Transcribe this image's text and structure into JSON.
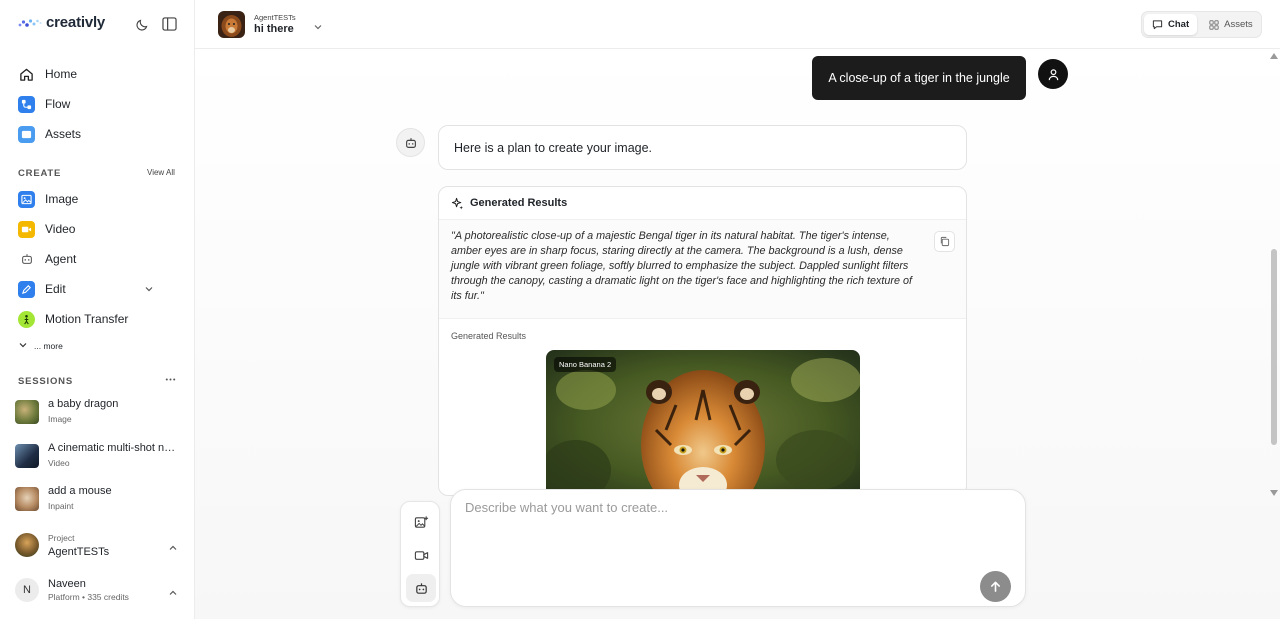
{
  "app": {
    "logo_text": "creativly"
  },
  "sidebar": {
    "nav": [
      {
        "label": "Home",
        "icon": "home-icon"
      },
      {
        "label": "Flow",
        "icon": "flow-icon"
      },
      {
        "label": "Assets",
        "icon": "folder-icon"
      }
    ],
    "create_label": "CREATE",
    "view_all": "View All",
    "create_items": [
      {
        "label": "Image",
        "icon": "image-icon"
      },
      {
        "label": "Video",
        "icon": "video-icon"
      },
      {
        "label": "Agent",
        "icon": "robot-icon"
      },
      {
        "label": "Edit",
        "icon": "pencil-icon"
      },
      {
        "label": "Motion Transfer",
        "icon": "person-icon"
      }
    ],
    "more_label": "... more",
    "sessions_label": "SESSIONS",
    "sessions": [
      {
        "title": "a baby dragon",
        "type": "Image"
      },
      {
        "title": "A cinematic multi-shot n…",
        "type": "Video"
      },
      {
        "title": "add a mouse",
        "type": "Inpaint"
      }
    ],
    "project": {
      "caption": "Project",
      "name": "AgentTESTs"
    },
    "user": {
      "initial": "N",
      "name": "Naveen",
      "plan": "Platform • 335 credits"
    }
  },
  "header": {
    "project_caption": "AgentTESTs",
    "project_title": "hi there",
    "tabs": [
      {
        "label": "Chat",
        "active": true
      },
      {
        "label": "Assets",
        "active": false
      }
    ]
  },
  "chat": {
    "user_message": "A close-up of a tiger in the jungle",
    "assistant_message": "Here is a plan to create your image.",
    "results_title": "Generated Results",
    "prompt": "\"A photorealistic close-up of a majestic Bengal tiger in its natural habitat. The tiger's intense, amber eyes are in sharp focus, staring directly at the camera. The background is a lush, dense jungle with vibrant green foliage, softly blurred to emphasize the subject. Dappled sunlight filters through the canopy, casting a dramatic light on the tiger's face and highlighting the rich texture of its fur.\"",
    "results_subtitle": "Generated Results",
    "image_model": "Nano Banana 2"
  },
  "composer": {
    "placeholder": "Describe what you want to create..."
  },
  "colors": {
    "send_button": "#8c8c8c",
    "user_bubble": "#1c1c1c",
    "flow_blue": "#2f80ed",
    "video_yellow": "#f5b800",
    "motion_green": "#a3e635"
  }
}
